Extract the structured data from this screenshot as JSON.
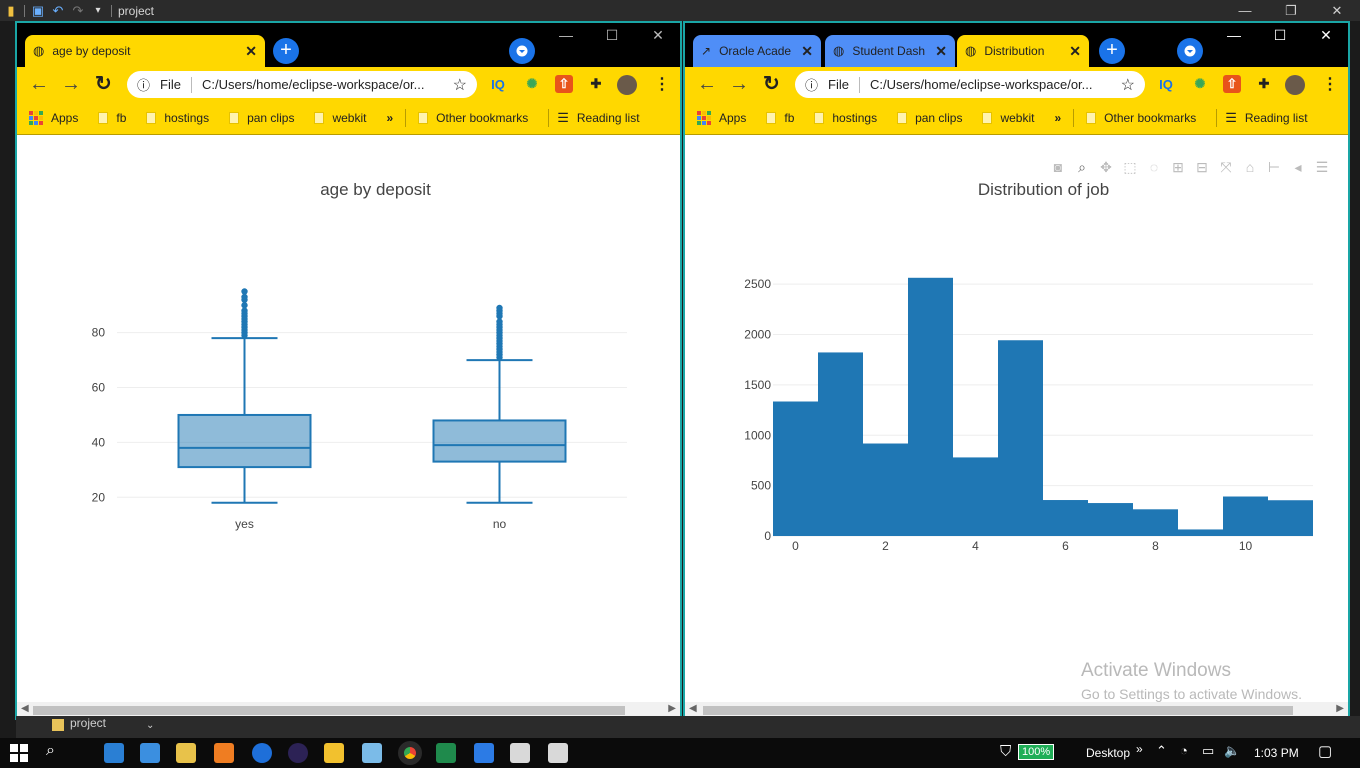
{
  "top_bar": {
    "title": "project"
  },
  "left_window": {
    "tab": {
      "label": "age by deposit",
      "close": "✕"
    },
    "new_tab": "+",
    "nav": {
      "back": "←",
      "forward": "→",
      "reload": "↻"
    },
    "omnibox": {
      "info": "ⓘ",
      "scheme": "File",
      "url": "C:/Users/home/eclipse-workspace/or...",
      "star": "☆"
    },
    "extensions": [
      "IQ",
      "⟳",
      "⇧",
      "✱",
      "avatar",
      "⋮"
    ],
    "bookmarks": [
      {
        "label": "Apps"
      },
      {
        "label": "fb"
      },
      {
        "label": "hostings"
      },
      {
        "label": "pan clips"
      },
      {
        "label": "webkit"
      }
    ],
    "more_bookmarks": "»",
    "other_bookmarks": "Other bookmarks",
    "reading_list": "Reading list",
    "chart_title": "age by deposit"
  },
  "right_window": {
    "tabs": [
      {
        "label": "Oracle Acade",
        "active": false
      },
      {
        "label": "Student Dash",
        "active": false
      },
      {
        "label": "Distribution",
        "active": true
      }
    ],
    "new_tab": "+",
    "nav": {
      "back": "←",
      "forward": "→",
      "reload": "↻"
    },
    "omnibox": {
      "info": "ⓘ",
      "scheme": "File",
      "url": "C:/Users/home/eclipse-workspace/or...",
      "star": "☆"
    },
    "bookmarks": [
      {
        "label": "Apps"
      },
      {
        "label": "fb"
      },
      {
        "label": "hostings"
      },
      {
        "label": "pan clips"
      },
      {
        "label": "webkit"
      }
    ],
    "more_bookmarks": "»",
    "other_bookmarks": "Other bookmarks",
    "reading_list": "Reading list",
    "chart_title": "Distribution of  job",
    "window_controls": [
      "—",
      "☐",
      "✕"
    ]
  },
  "activate_windows": {
    "title": "Activate Windows",
    "subtitle": "Go to Settings to activate Windows."
  },
  "project_strip": {
    "label": "project"
  },
  "taskbar": {
    "battery": "100%",
    "desktop": "Desktop",
    "chevron": "»",
    "time": "1:03 PM"
  },
  "colors": {
    "accent_yellow": "#ffd800",
    "plot_blue": "#1f77b4",
    "tab_blue": "#4f8ef7"
  },
  "chart_data": [
    {
      "type": "box",
      "title": "age by deposit",
      "categories": [
        "yes",
        "no"
      ],
      "boxes": [
        {
          "name": "yes",
          "min": 18,
          "q1": 31,
          "median": 38,
          "q3": 50,
          "max": 78,
          "outliers": [
            79,
            80,
            81,
            82,
            83,
            84,
            85,
            86,
            87,
            88,
            90,
            92,
            93,
            95
          ]
        },
        {
          "name": "no",
          "min": 18,
          "q1": 33,
          "median": 39,
          "q3": 48,
          "max": 70,
          "outliers": [
            71,
            72,
            73,
            74,
            75,
            76,
            77,
            78,
            79,
            80,
            81,
            82,
            83,
            84,
            86,
            87,
            88,
            89
          ]
        }
      ],
      "yticks": [
        20,
        40,
        60,
        80
      ],
      "ylim": [
        15,
        97
      ]
    },
    {
      "type": "bar",
      "title": "Distribution of  job",
      "bins": [
        {
          "x0": -0.5,
          "x1": 0.5,
          "value": 1335
        },
        {
          "x0": 0.5,
          "x1": 1.5,
          "value": 1822
        },
        {
          "x0": 1.5,
          "x1": 2.5,
          "value": 918
        },
        {
          "x0": 2.5,
          "x1": 3.5,
          "value": 2563
        },
        {
          "x0": 3.5,
          "x1": 4.5,
          "value": 780
        },
        {
          "x0": 4.5,
          "x1": 5.5,
          "value": 1943
        },
        {
          "x0": 5.5,
          "x1": 6.5,
          "value": 357
        },
        {
          "x0": 6.5,
          "x1": 7.5,
          "value": 327
        },
        {
          "x0": 7.5,
          "x1": 8.5,
          "value": 265
        },
        {
          "x0": 8.5,
          "x1": 9.5,
          "value": 65
        },
        {
          "x0": 9.5,
          "x1": 10.5,
          "value": 392
        },
        {
          "x0": 10.5,
          "x1": 11.5,
          "value": 355
        }
      ],
      "xticks": [
        0,
        2,
        4,
        6,
        8,
        10
      ],
      "yticks": [
        0,
        500,
        1000,
        1500,
        2000,
        2500
      ],
      "xlim": [
        -0.5,
        11.5
      ],
      "ylim": [
        0,
        2680
      ]
    }
  ]
}
